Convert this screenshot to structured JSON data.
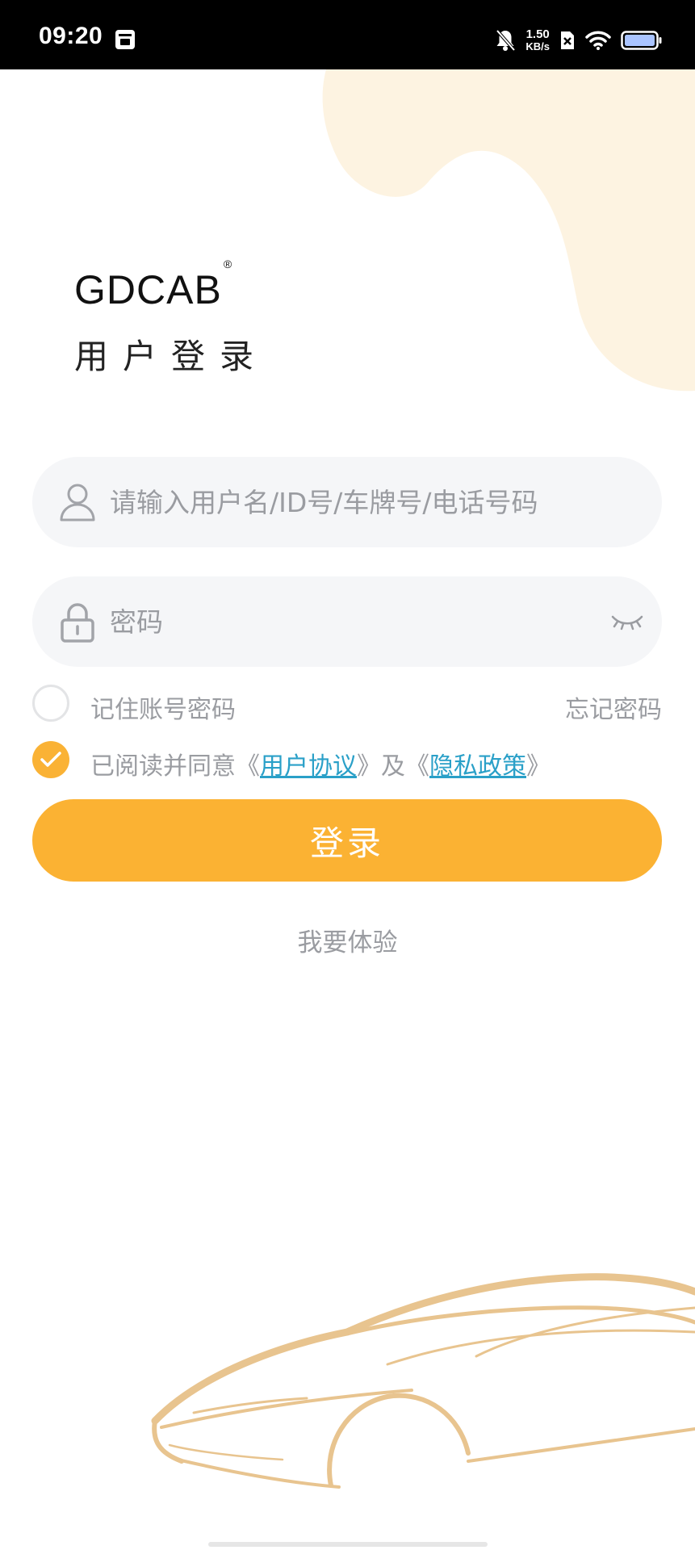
{
  "status_bar": {
    "time": "09:20",
    "net_speed_value": "1.50",
    "net_speed_unit": "KB/s",
    "icons": [
      "notification-app-icon",
      "mute-bell-icon",
      "sim-off-icon",
      "wifi-icon",
      "battery-icon"
    ]
  },
  "header": {
    "brand": "GDCAB",
    "brand_mark": "®",
    "title": "用户登录"
  },
  "login_form": {
    "username_placeholder": "请输入用户名/ID号/车牌号/电话号码",
    "username_value": "",
    "password_placeholder": "密码",
    "password_value": "",
    "remember_label": "记住账号密码",
    "remember_checked": false,
    "forgot_label": "忘记密码",
    "agree_checked": true,
    "agree_prefix": "已阅读并同意《",
    "user_agreement": "用户协议",
    "agree_middle": "》及《",
    "privacy_policy": "隐私政策",
    "agree_suffix": "》",
    "login_button": "登录",
    "trial_link": "我要体验"
  },
  "colors": {
    "accent": "#fbb233",
    "link": "#2aa0c8",
    "muted_text": "#9a9ca1",
    "field_bg": "#f5f6f8",
    "decor": "#fdf3e1",
    "car_line": "#e8c48f"
  }
}
